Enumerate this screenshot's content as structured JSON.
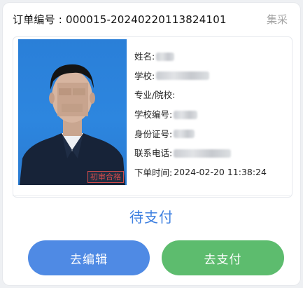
{
  "order": {
    "title": "订单编号 : 000015-20240220113824101",
    "source": "集采"
  },
  "photo": {
    "stamp": "初审合格"
  },
  "info": {
    "rows": [
      {
        "label": "姓名:",
        "value": ""
      },
      {
        "label": "学校:",
        "value": ""
      },
      {
        "label": "专业/院校:",
        "value": ""
      },
      {
        "label": "学校编号:",
        "value": ""
      },
      {
        "label": "身份证号:",
        "value": ""
      },
      {
        "label": "联系电话:",
        "value": ""
      },
      {
        "label": "下单时间:",
        "value": "2024-02-20 11:38:24"
      }
    ]
  },
  "status": "待支付",
  "buttons": {
    "edit": "去编辑",
    "pay": "去支付"
  },
  "colors": {
    "status": "#3d7fe0",
    "edit_button": "#4f8ae4",
    "pay_button": "#5dbc6e",
    "stamp": "#d04a4a",
    "photo_background": "#2d86df"
  }
}
